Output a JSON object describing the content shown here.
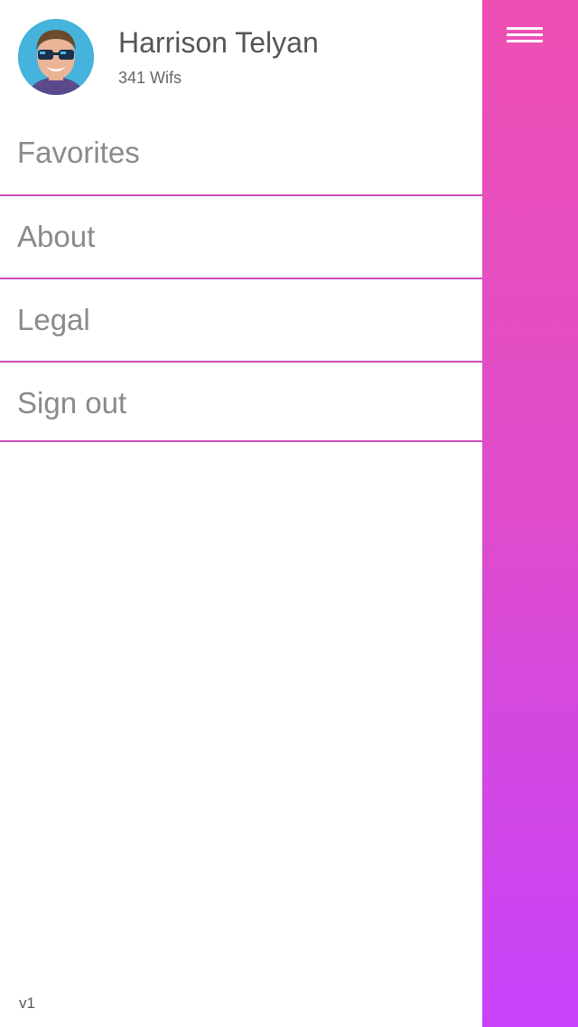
{
  "profile": {
    "name": "Harrison Telyan",
    "subtitle": "341 Wifs"
  },
  "menu": {
    "items": [
      {
        "label": "Favorites"
      },
      {
        "label": "About"
      },
      {
        "label": "Legal"
      },
      {
        "label": "Sign out"
      }
    ]
  },
  "footer": {
    "version": "v1"
  },
  "icons": {
    "menu": "hamburger-menu-icon",
    "avatar": "user-avatar"
  },
  "colors": {
    "divider": "#cc4fbf",
    "panel_top": "#ee4fb3",
    "panel_bottom": "#c743fb",
    "menu_text": "#8a8a8a"
  }
}
